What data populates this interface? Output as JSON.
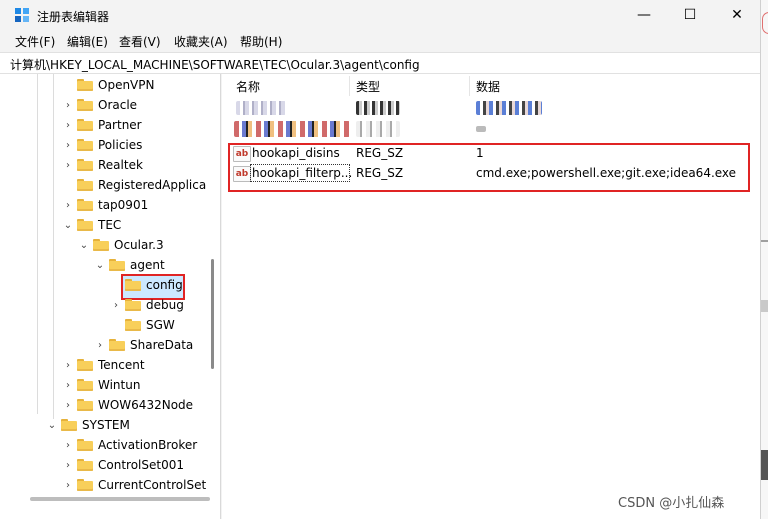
{
  "window": {
    "title": "注册表编辑器",
    "minimize": "—",
    "maximize": "☐",
    "close": "✕"
  },
  "menu": [
    "文件(F)",
    "编辑(E)",
    "查看(V)",
    "收藏夹(A)",
    "帮助(H)"
  ],
  "address": "计算机\\HKEY_LOCAL_MACHINE\\SOFTWARE\\TEC\\Ocular.3\\agent\\config",
  "tree": {
    "openvpn": "OpenVPN",
    "oracle": "Oracle",
    "partner": "Partner",
    "policies": "Policies",
    "realtek": "Realtek",
    "registered": "RegisteredApplica",
    "tap0901": "tap0901",
    "tec": "TEC",
    "ocular3": "Ocular.3",
    "agent": "agent",
    "config": "config",
    "debug": "debug",
    "sgw": "SGW",
    "sharedata": "ShareData",
    "tencent": "Tencent",
    "wintun": "Wintun",
    "wow6432": "WOW6432Node",
    "system": "SYSTEM",
    "activationbroker": "ActivationBroker",
    "controlset001": "ControlSet001",
    "currentcontrolset": "CurrentControlSet"
  },
  "columns": {
    "name": "名称",
    "type": "类型",
    "data": "数据"
  },
  "values": [
    {
      "icon": "ab",
      "name": "hookapi_disins",
      "type": "REG_SZ",
      "data": "1"
    },
    {
      "icon": "ab",
      "name": "hookapi_filterp...",
      "type": "REG_SZ",
      "data": "cmd.exe;powershell.exe;git.exe;idea64.exe"
    }
  ],
  "watermark": "CSDN @小扎仙森",
  "colors": {
    "highlight": "#e02424",
    "selection": "#cce8ff",
    "folder": "#f8cf5a"
  }
}
